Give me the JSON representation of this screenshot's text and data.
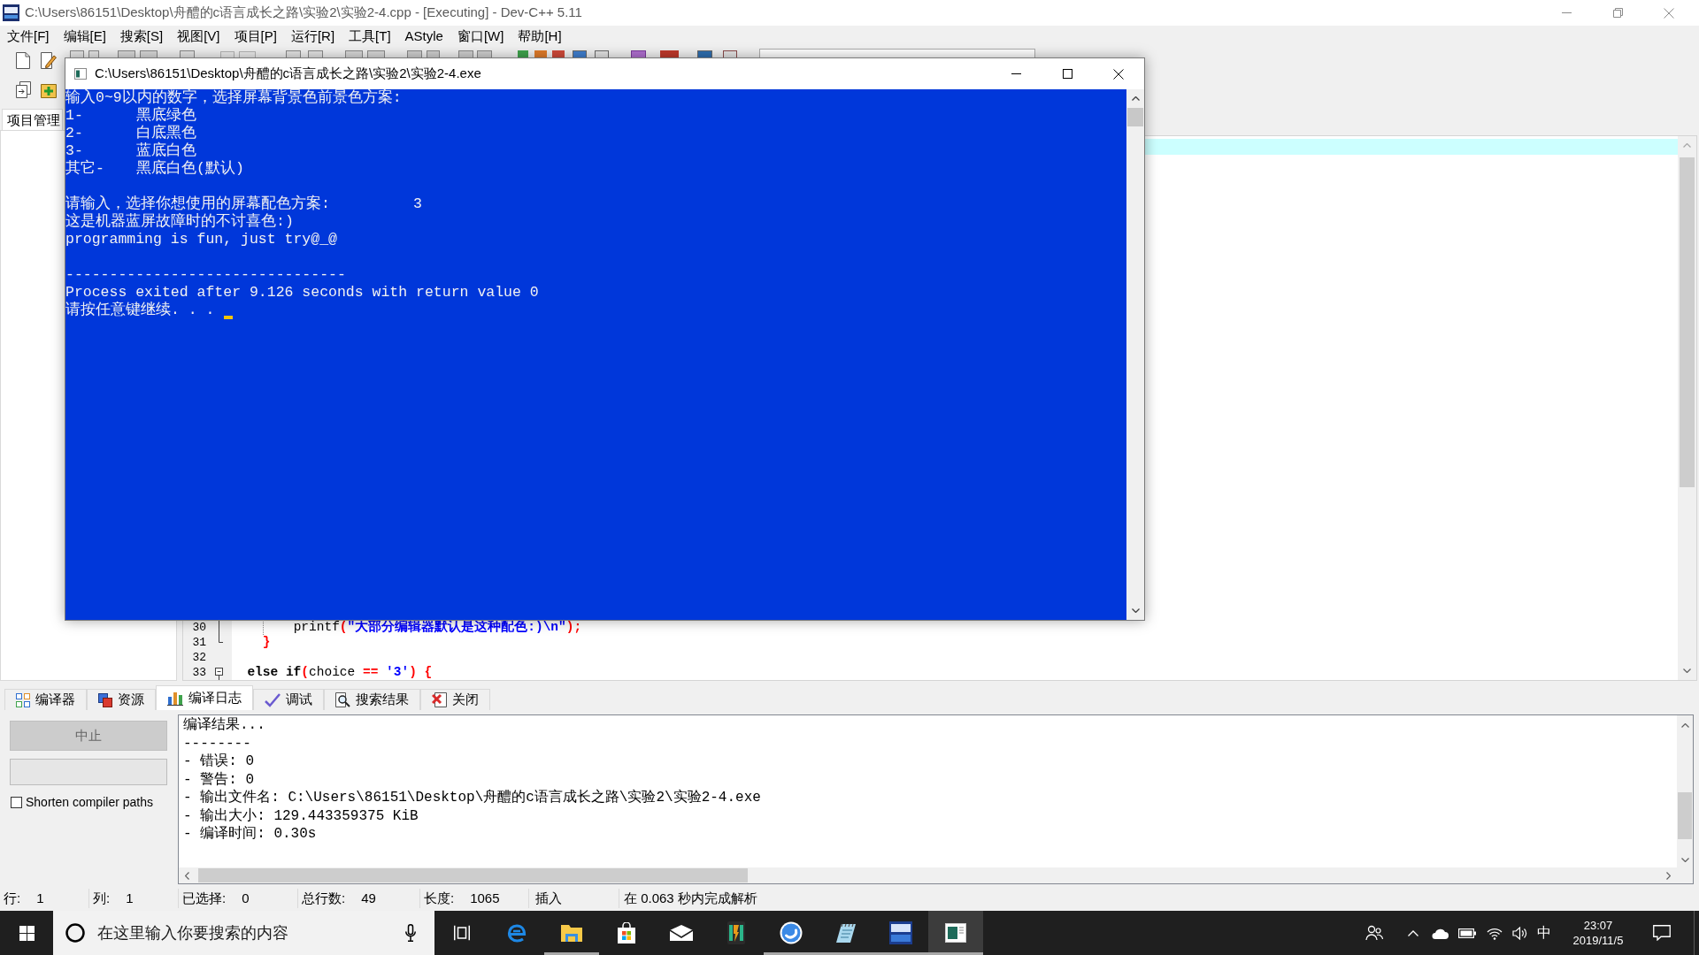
{
  "ide_window": {
    "title": "C:\\Users\\86151\\Desktop\\舟醴的c语言成长之路\\实验2\\实验2-4.cpp - [Executing] - Dev-C++ 5.11",
    "menu": [
      "文件[F]",
      "编辑[E]",
      "搜索[S]",
      "视图[V]",
      "项目[P]",
      "运行[R]",
      "工具[T]",
      "AStyle",
      "窗口[W]",
      "帮助[H]"
    ],
    "project_panel": {
      "tab": "项目管理"
    },
    "editor": {
      "current_line_highlight": true,
      "lines": [
        {
          "number": "30",
          "fold": {
            "kind": "line"
          },
          "indent_guide": true,
          "tokens": [
            {
              "kind": "plain",
              "text": "        printf"
            },
            {
              "kind": "symbol",
              "text": "("
            },
            {
              "kind": "string",
              "text": "\"大部分编辑器默认是这种配色:)\\n\""
            },
            {
              "kind": "symbol",
              "text": ");"
            }
          ]
        },
        {
          "number": "31",
          "fold": {
            "kind": "end"
          },
          "indent_guide": false,
          "tokens": [
            {
              "kind": "symbol",
              "text": "    }"
            }
          ]
        },
        {
          "number": "32",
          "indent_guide": false
        },
        {
          "number": "33",
          "fold": {
            "kind": "start"
          },
          "indent_guide": false,
          "tokens": [
            {
              "kind": "keyword",
              "text": "  else if"
            },
            {
              "kind": "symbol",
              "text": "("
            },
            {
              "kind": "plain",
              "text": "choice "
            },
            {
              "kind": "symbol",
              "text": "=="
            },
            {
              "kind": "string",
              "text": " '3'"
            },
            {
              "kind": "symbol",
              "text": ") {"
            }
          ]
        }
      ]
    },
    "bottom_panel": {
      "tabs": [
        {
          "label": "编译器",
          "selected": false
        },
        {
          "label": "资源",
          "selected": false
        },
        {
          "label": "编译日志",
          "selected": true
        },
        {
          "label": "调试",
          "selected": false
        },
        {
          "label": "搜索结果",
          "selected": false
        },
        {
          "label": "关闭",
          "selected": false
        }
      ],
      "abort_button": {
        "label": "中止",
        "disabled": true
      },
      "shorten_paths": {
        "label": "Shorten compiler paths",
        "checked": false
      },
      "log": [
        "编译结果...",
        "--------",
        "- 错误: 0",
        "- 警告: 0",
        "- 输出文件名: C:\\Users\\86151\\Desktop\\舟醴的c语言成长之路\\实验2\\实验2-4.exe",
        "- 输出大小: 129.443359375 KiB",
        "- 编译时间: 0.30s"
      ]
    },
    "status_bar": {
      "fields": [
        {
          "label": "行:",
          "value": "1"
        },
        {
          "label": "列:",
          "value": "1"
        },
        {
          "label": "已选择:",
          "value": "0"
        },
        {
          "label": "总行数:",
          "value": "49"
        },
        {
          "label": "长度:",
          "value": "1065"
        }
      ],
      "mode": "插入",
      "message": "在 0.063 秒内完成解析"
    }
  },
  "console_window": {
    "title": "C:\\Users\\86151\\Desktop\\舟醴的c语言成长之路\\实验2\\实验2-4.exe",
    "lines": [
      {
        "kind": "text",
        "text": "输入0~9以内的数字，选择屏幕背景色前景色方案:"
      },
      {
        "kind": "option",
        "code": "1-",
        "scheme": "黑底绿色"
      },
      {
        "kind": "option",
        "code": "2-",
        "scheme": "白底黑色"
      },
      {
        "kind": "option",
        "code": "3-",
        "scheme": "蓝底白色"
      },
      {
        "kind": "option",
        "code": "其它-",
        "scheme": "黑底白色(默认)"
      },
      {
        "kind": "blank"
      },
      {
        "kind": "prompt",
        "text": "请输入，选择你想使用的屏幕配色方案:",
        "input": "3"
      },
      {
        "kind": "text",
        "text": "这是机器蓝屏故障时的不讨喜色:)"
      },
      {
        "kind": "text",
        "text": "programming is fun, just try@_@"
      },
      {
        "kind": "blank"
      },
      {
        "kind": "text",
        "text": "--------------------------------"
      },
      {
        "kind": "text",
        "text": "Process exited after 9.126 seconds with return value 0"
      },
      {
        "kind": "pause",
        "text": "请按任意键继续. . .",
        "cursor": true
      }
    ]
  },
  "taskbar": {
    "search": {
      "placeholder": "在这里输入你要搜索的内容"
    },
    "apps": [
      {
        "running": false,
        "focused": false
      },
      {
        "running": true,
        "focused": false
      },
      {
        "running": false,
        "focused": false
      },
      {
        "running": false,
        "focused": false
      },
      {
        "running": false,
        "focused": false
      },
      {
        "running": true,
        "focused": false
      },
      {
        "running": true,
        "focused": false
      },
      {
        "running": true,
        "focused": false
      },
      {
        "running": true,
        "focused": true
      }
    ],
    "ime": "中",
    "clock": {
      "time": "23:07",
      "date": "2019/11/5"
    }
  }
}
